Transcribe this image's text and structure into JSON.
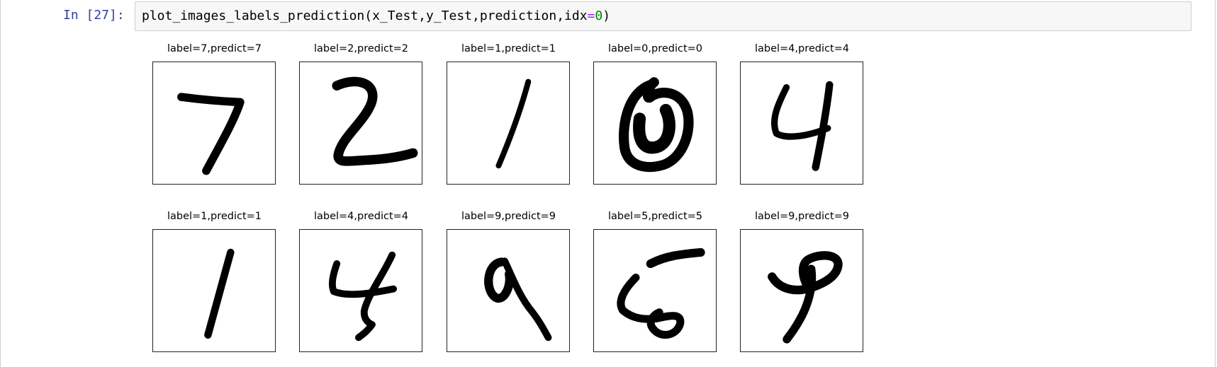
{
  "cell": {
    "prompt": "In [27]:",
    "code_parts": [
      "plot_images_labels_prediction(x_Test,y_Test,prediction,idx",
      "=",
      "0",
      ")"
    ]
  },
  "panels": [
    {
      "title": "label=7,predict=7",
      "digit": "7"
    },
    {
      "title": "label=2,predict=2",
      "digit": "2"
    },
    {
      "title": "label=1,predict=1",
      "digit": "1"
    },
    {
      "title": "label=0,predict=0",
      "digit": "0"
    },
    {
      "title": "label=4,predict=4",
      "digit": "4"
    },
    {
      "title": "label=1,predict=1",
      "digit": "1b"
    },
    {
      "title": "label=4,predict=4",
      "digit": "4b"
    },
    {
      "title": "label=9,predict=9",
      "digit": "9"
    },
    {
      "title": "label=5,predict=5",
      "digit": "5"
    },
    {
      "title": "label=9,predict=9",
      "digit": "9b"
    }
  ],
  "colors": {
    "prompt": "#303f9f",
    "operator": "#aa22ff",
    "number": "#008800"
  }
}
